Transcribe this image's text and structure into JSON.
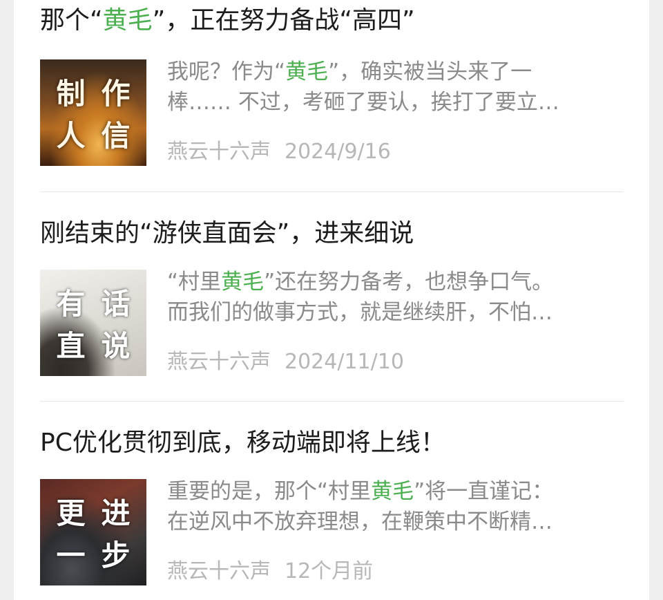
{
  "articles": [
    {
      "title_before": "那个“",
      "title_highlight": "黄毛",
      "title_after": "”，正在努力备战“高四”",
      "thumb_chars": [
        "制",
        "作",
        "人",
        "信"
      ],
      "summary_line1_before": "我呢？作为“",
      "summary_line1_highlight": "黄毛",
      "summary_line1_after": "”，确实被当头来了一",
      "summary_line2": "棒…… 不过，考砸了要认，挨打了要立…",
      "source": "燕云十六声",
      "date": "2024/9/16"
    },
    {
      "title_before": "刚结束的“游侠直面会”，进来细说",
      "title_highlight": "",
      "title_after": "",
      "thumb_chars": [
        "有",
        "话",
        "直",
        "说"
      ],
      "summary_line1_before": "“村里",
      "summary_line1_highlight": "黄毛",
      "summary_line1_after": "”还在努力备考，也想争口气。",
      "summary_line2": "而我们的做事方式，就是继续肝，不怕…",
      "source": "燕云十六声",
      "date": "2024/11/10"
    },
    {
      "title_before": "PC优化贯彻到底，移动端即将上线！",
      "title_highlight": "",
      "title_after": "",
      "thumb_chars": [
        "更",
        "进",
        "一",
        "步"
      ],
      "summary_line1_before": "重要的是，那个“村里",
      "summary_line1_highlight": "黄毛",
      "summary_line1_after": "”将一直谨记：",
      "summary_line2": "在逆风中不放弃理想，在鞭策中不断精…",
      "source": "燕云十六声",
      "date": "12个月前"
    }
  ],
  "colors": {
    "highlight": "#4caf50",
    "title": "#1c1c1c",
    "summary": "#8a8a8a",
    "meta": "#b7b7b7"
  }
}
